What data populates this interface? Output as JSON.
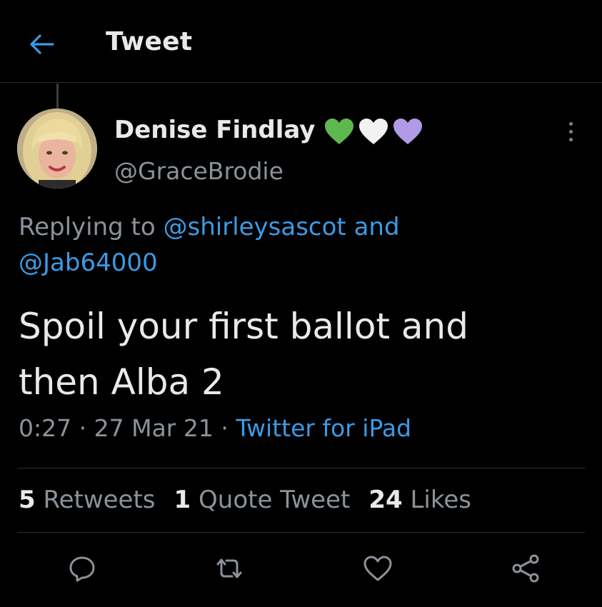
{
  "header": {
    "title": "Tweet",
    "back_icon": "arrow-left-icon"
  },
  "tweet": {
    "author": {
      "display_name": "Denise Findlay",
      "handle": "@GraceBrodie",
      "name_emojis": [
        {
          "name": "green-heart-icon",
          "color": "#5fb84f"
        },
        {
          "name": "white-heart-icon",
          "color": "#f2f2f2"
        },
        {
          "name": "purple-heart-icon",
          "color": "#b19ae6"
        }
      ]
    },
    "replying": {
      "prefix": "Replying to",
      "mention1": "@shirleysascot",
      "conjunction": "and",
      "mention2": "@Jab64000"
    },
    "text_line1": "Spoil your first ballot and",
    "text_line2": "then Alba 2",
    "time": "0:27",
    "separator": "·",
    "date": "27 Mar 21",
    "source": "Twitter for iPad"
  },
  "stats": {
    "retweets_count": "5",
    "retweets_label": "Retweets",
    "quotes_count": "1",
    "quotes_label": "Quote Tweet",
    "likes_count": "24",
    "likes_label": "Likes"
  },
  "actions": [
    "reply-icon",
    "retweet-icon",
    "like-icon",
    "share-icon"
  ],
  "colors": {
    "background": "#000000",
    "text": "#e7e9ea",
    "secondary": "#8b9299",
    "link": "#3b9be6"
  }
}
